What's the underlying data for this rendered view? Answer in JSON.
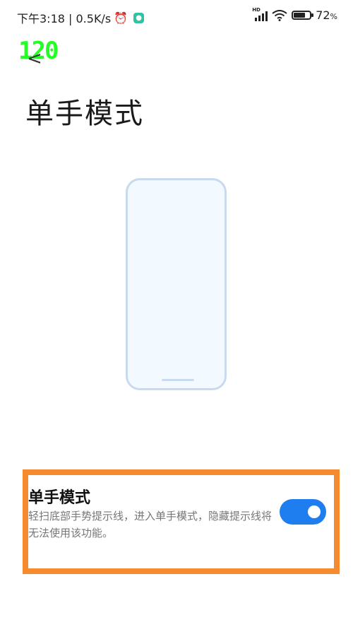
{
  "status_bar": {
    "time_speed": "下午3:18 | 0.5K/s",
    "hd_label": "HD",
    "battery_percent": "72",
    "percent_sign": "%",
    "battery_level": 0.72
  },
  "fps_overlay": "120",
  "header": {
    "back_glyph": "<",
    "title": "单手模式"
  },
  "setting": {
    "title": "单手模式",
    "description": "轻扫底部手势提示线，进入单手模式，隐藏提示线将无法使用该功能。",
    "toggle_on": true
  },
  "colors": {
    "accent": "#1e7ef0",
    "highlight": "#f58a2e",
    "phone_outline": "#c9d9ee"
  }
}
